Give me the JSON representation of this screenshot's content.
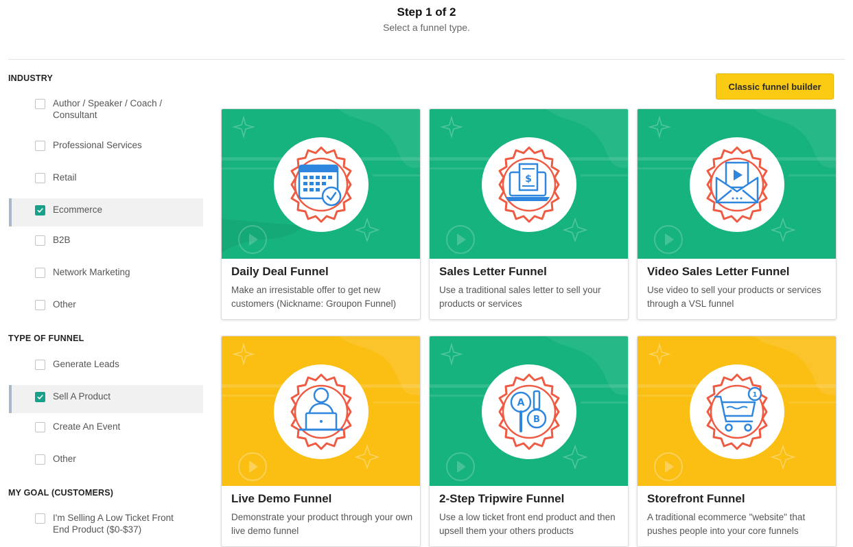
{
  "header": {
    "step": "Step 1 of 2",
    "subtitle": "Select a funnel type."
  },
  "sidebar": {
    "industry": {
      "title": "INDUSTRY",
      "options": [
        {
          "label": "Author / Speaker / Coach / Consultant",
          "checked": false
        },
        {
          "label": "Professional Services",
          "checked": false
        },
        {
          "label": "Retail",
          "checked": false
        },
        {
          "label": "Ecommerce",
          "checked": true
        },
        {
          "label": "B2B",
          "checked": false
        },
        {
          "label": "Network Marketing",
          "checked": false
        },
        {
          "label": "Other",
          "checked": false
        }
      ]
    },
    "type_of_funnel": {
      "title": "TYPE OF FUNNEL",
      "options": [
        {
          "label": "Generate Leads",
          "checked": false
        },
        {
          "label": "Sell A Product",
          "checked": true
        },
        {
          "label": "Create An Event",
          "checked": false
        },
        {
          "label": "Other",
          "checked": false
        }
      ]
    },
    "my_goal": {
      "title": "MY GOAL (CUSTOMERS)",
      "options": [
        {
          "label": "I'm Selling A Low Ticket Front End Product ($0-$37)",
          "checked": false
        }
      ]
    }
  },
  "toolbar": {
    "classic_label": "Classic funnel builder"
  },
  "colors": {
    "green": "#17b37f",
    "yellow": "#fbbe12",
    "accent_check": "#18a08a",
    "button": "#fbcb14",
    "gear_red": "#ef5a42",
    "icon_blue": "#2e86de"
  },
  "cards": [
    {
      "title": "Daily Deal Funnel",
      "desc": "Make an irresistable offer to get new customers (Nickname: Groupon Funnel)",
      "theme": "green",
      "icon": "calendar-check-icon"
    },
    {
      "title": "Sales Letter Funnel",
      "desc": "Use a traditional sales letter to sell your products or services",
      "theme": "green",
      "icon": "laptop-letter-icon"
    },
    {
      "title": "Video Sales Letter Funnel",
      "desc": "Use video to sell your products or services through a VSL funnel",
      "theme": "green",
      "icon": "video-envelope-icon"
    },
    {
      "title": "Live Demo Funnel",
      "desc": "Demonstrate your product through your own live demo funnel",
      "theme": "yellow",
      "icon": "presenter-laptop-icon"
    },
    {
      "title": "2-Step Tripwire Funnel",
      "desc": "Use a low ticket front end product and then upsell them your others products",
      "theme": "green",
      "icon": "ab-test-icon"
    },
    {
      "title": "Storefront Funnel",
      "desc": "A traditional ecommerce \"website\" that pushes people into your core funnels",
      "theme": "yellow",
      "icon": "shopping-cart-icon"
    }
  ]
}
